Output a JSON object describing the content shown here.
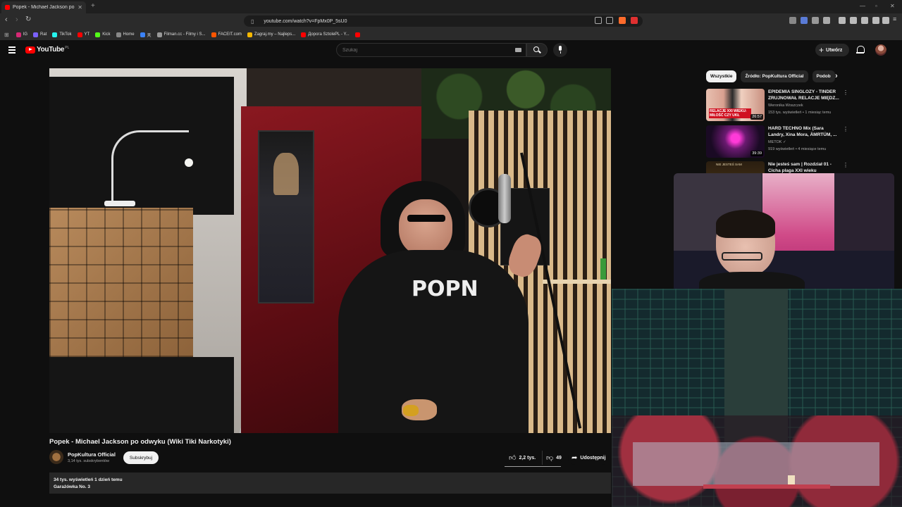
{
  "browser": {
    "tab_title": "Popek - Michael Jackson po o",
    "new_tab": "+",
    "url": "youtube.com/watch?v=FpMx0P_5sU0",
    "bookmarks": [
      {
        "label": "IG",
        "color": "#d62976"
      },
      {
        "label": "Rat",
        "color": "#7b61ff"
      },
      {
        "label": "TikTok",
        "color": "#25f4ee"
      },
      {
        "label": "YT",
        "color": "#ff0000"
      },
      {
        "label": "Kick",
        "color": "#53fc18"
      },
      {
        "label": "Home",
        "color": "#888888"
      },
      {
        "label": "天",
        "color": "#3b82f6"
      },
      {
        "label": "Filman.cc - Filmy i S...",
        "color": "#999999"
      },
      {
        "label": "FACEIT.com",
        "color": "#ff5500"
      },
      {
        "label": "Zagraj.my – Najleps...",
        "color": "#f5b700"
      },
      {
        "label": "Дорога SztolePL - Y...",
        "color": "#ff0000"
      }
    ]
  },
  "youtube": {
    "logo_text": "YouTube",
    "region": "PL",
    "search_placeholder": "Szukaj",
    "create_label": "Utwórz"
  },
  "video": {
    "title": "Popek - Michael Jackson po odwyku (Wiki Tiki Narkotyki)",
    "channel": "PopKultura Official",
    "subscribers": "3,14 tys. subskrybentów",
    "subscribe_label": "Subskrybuj",
    "likes": "2,2 tys.",
    "dislikes": "49",
    "share_label": "Udostępnij",
    "views_date": "34 tys. wyświetleń  1 dzień temu",
    "description": "Garażówka No. 3"
  },
  "sidebar": {
    "chips": [
      "Wszystkie",
      "Źródło: PopKultura Official",
      "Podob"
    ],
    "recommendations": [
      {
        "title": "EPIDEMIA SINGLOZY - TINDER ZRUJNOWAŁ RELACJE MIĘDZ...",
        "channel": "Weronika Woszczek",
        "meta": "153 tys. wyświetleń • 1 miesiąc temu",
        "duration": "26:57",
        "thumb_text": "RELACJE XXI WIEKU: MIŁOŚĆ CZY UKŁ"
      },
      {
        "title": "HARD TECHNO Mix (Sara Landry, Xina Mora, ÄMRTÜM, ...",
        "channel": "METOK ✓",
        "meta": "919 wyświetleń • 4 miesiące temu",
        "duration": "39:39",
        "thumb_text": ""
      },
      {
        "title": "Nie jesteś sam | Rozdział 01 - Cicha plaga XXI wieku",
        "channel": "",
        "meta": "",
        "duration": "",
        "thumb_text": "NIE JESTEŚ SAM"
      }
    ]
  },
  "overlay": {
    "video_text": "POPN"
  }
}
